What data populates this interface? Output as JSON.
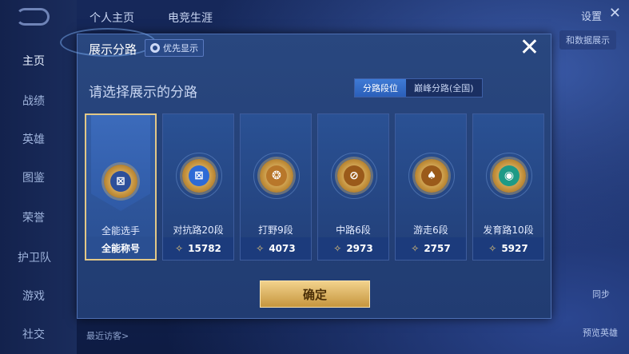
{
  "top_nav": {
    "tabs": [
      "个人主页",
      "电竞生涯"
    ],
    "settings": "设置",
    "data_display": "和数据展示"
  },
  "side_nav": {
    "items": [
      "主页",
      "战绩",
      "英雄",
      "图鉴",
      "荣誉",
      "护卫队",
      "游戏",
      "社交"
    ]
  },
  "footer": {
    "recent_visitors": "最近访客>",
    "hero_label": "同步",
    "preview_label": "预览英雄"
  },
  "modal": {
    "title": "展示分路",
    "priority_button": "优先显示",
    "subtitle": "请选择展示的分路",
    "segment": [
      "分路段位",
      "巅峰分路(全国)"
    ],
    "confirm": "确定",
    "cards": [
      {
        "name": "全能选手",
        "footer": "全能称号",
        "selected": true,
        "glyph": "⊠",
        "color": "#2d4f9a"
      },
      {
        "name": "对抗路20段",
        "footer": "15782",
        "selected": false,
        "glyph": "⊠",
        "color": "#2d6ad6"
      },
      {
        "name": "打野9段",
        "footer": "4073",
        "selected": false,
        "glyph": "❂",
        "color": "#b8772a"
      },
      {
        "name": "中路6段",
        "footer": "2973",
        "selected": false,
        "glyph": "⊘",
        "color": "#9a5a1a"
      },
      {
        "name": "游走6段",
        "footer": "2757",
        "selected": false,
        "glyph": "♠",
        "color": "#9a5a1a"
      },
      {
        "name": "发育路10段",
        "footer": "5927",
        "selected": false,
        "glyph": "◉",
        "color": "#1e9a86"
      }
    ]
  }
}
